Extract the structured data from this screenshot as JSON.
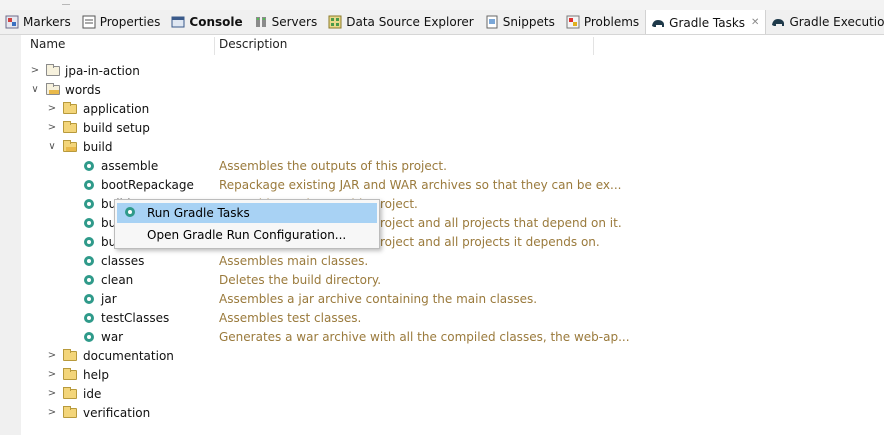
{
  "tabs": [
    {
      "label": "Markers",
      "icon": "markers-icon",
      "active": false,
      "bold": false
    },
    {
      "label": "Properties",
      "icon": "properties-icon",
      "active": false,
      "bold": false
    },
    {
      "label": "Console",
      "icon": "console-icon",
      "active": false,
      "bold": true
    },
    {
      "label": "Servers",
      "icon": "servers-icon",
      "active": false,
      "bold": false
    },
    {
      "label": "Data Source Explorer",
      "icon": "data-source-icon",
      "active": false,
      "bold": false
    },
    {
      "label": "Snippets",
      "icon": "snippets-icon",
      "active": false,
      "bold": false
    },
    {
      "label": "Problems",
      "icon": "problems-icon",
      "active": false,
      "bold": false
    },
    {
      "label": "Gradle Tasks",
      "icon": "gradle-elephant-icon",
      "active": true,
      "bold": false
    },
    {
      "label": "Gradle Executions",
      "icon": "gradle-elephant-icon",
      "active": false,
      "bold": false
    }
  ],
  "columns": {
    "name": "Name",
    "description": "Description"
  },
  "tree": {
    "jpa_in_action": "jpa-in-action",
    "words": "words",
    "application": "application",
    "build_setup": "build setup",
    "build_group": "build",
    "tasks": [
      {
        "name": "assemble",
        "description": "Assembles the outputs of this project."
      },
      {
        "name": "bootRepackage",
        "description": "Repackage existing JAR and WAR archives so that they can be ex..."
      },
      {
        "name": "build",
        "description": "Assembles and tests this project."
      },
      {
        "name": "buildDependents",
        "description": "Assembles and tests this project and all projects that depend on it."
      },
      {
        "name": "buildNeeded",
        "description": "Assembles and tests this project and all projects it depends on."
      },
      {
        "name": "classes",
        "description": "Assembles main classes."
      },
      {
        "name": "clean",
        "description": "Deletes the build directory."
      },
      {
        "name": "jar",
        "description": "Assembles a jar archive containing the main classes."
      },
      {
        "name": "testClasses",
        "description": "Assembles test classes."
      },
      {
        "name": "war",
        "description": "Generates a war archive with all the compiled classes, the web-ap..."
      }
    ],
    "documentation": "documentation",
    "help": "help",
    "ide": "ide",
    "verification": "verification"
  },
  "context_menu": {
    "items": [
      {
        "label": "Run Gradle Tasks",
        "selected": true
      },
      {
        "label": "Open Gradle Run Configuration...",
        "selected": false
      }
    ]
  },
  "colors": {
    "description_text": "#9a7a3c",
    "menu_highlight": "#a8d2f4",
    "gear": "#2f9a8a"
  }
}
